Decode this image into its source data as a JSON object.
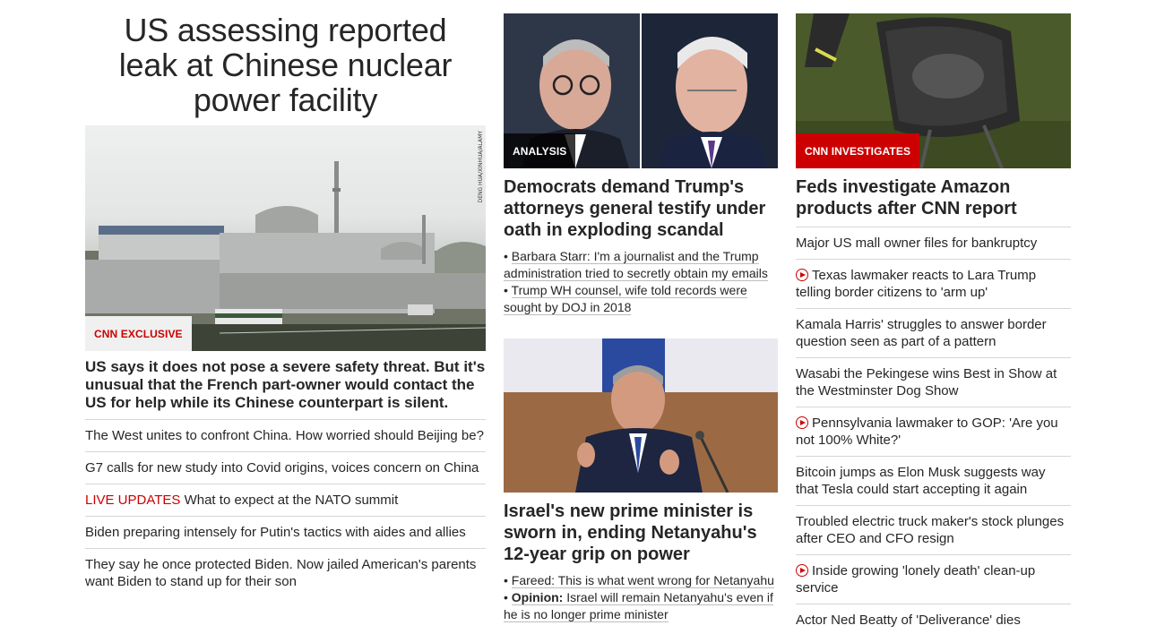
{
  "lead": {
    "headline": "US assessing reported leak at Chinese nuclear power facility",
    "image_credit": "DENG HUA/XINHUA/ALAMY",
    "badge": "CNN EXCLUSIVE",
    "summary": "US says it does not pose a severe safety threat. But it's unusual that the French part-owner would contact the US for help while its Chinese counterpart is silent.",
    "stories": [
      {
        "prefix": "",
        "text": "The West unites to confront China. How worried should Beijing be?"
      },
      {
        "prefix": "",
        "text": "G7 calls for new study into Covid origins, voices concern on China"
      },
      {
        "prefix": "LIVE UPDATES",
        "text": "What to expect at the NATO summit"
      },
      {
        "prefix": "",
        "text": "Biden preparing intensely for Putin's tactics with aides and allies"
      },
      {
        "prefix": "",
        "text": "They say he once protected Biden. Now jailed American's parents want Biden to stand up for their son"
      }
    ]
  },
  "middle": {
    "story1": {
      "badge": "ANALYSIS",
      "headline": "Democrats demand Trump's attorneys general testify under oath in exploding scandal",
      "links": [
        {
          "label": "",
          "text": "Barbara Starr: I'm a journalist and the Trump administration tried to secretly obtain my emails"
        },
        {
          "label": "",
          "text": "Trump WH counsel, wife told records were sought by DOJ in 2018"
        }
      ]
    },
    "story2": {
      "headline": "Israel's new prime minister is sworn in, ending Netanyahu's 12-year grip on power",
      "links": [
        {
          "label": "",
          "text": "Fareed: This is what went wrong for Netanyahu"
        },
        {
          "label": "Opinion:",
          "text": "Israel will remain Netanyahu's even if he is no longer prime minister"
        }
      ]
    }
  },
  "right": {
    "badge": "CNN INVESTIGATES",
    "headline": "Feds investigate Amazon products after CNN report",
    "stories": [
      {
        "video": false,
        "text": "Major US mall owner files for bankruptcy"
      },
      {
        "video": true,
        "text": "Texas lawmaker reacts to Lara Trump telling border citizens to 'arm up'"
      },
      {
        "video": false,
        "text": "Kamala Harris' struggles to answer border question seen as part of a pattern"
      },
      {
        "video": false,
        "text": "Wasabi the Pekingese wins Best in Show at the Westminster Dog Show"
      },
      {
        "video": true,
        "text": "Pennsylvania lawmaker to GOP: 'Are you not 100% White?'"
      },
      {
        "video": false,
        "text": "Bitcoin jumps as Elon Musk suggests way that Tesla could start accepting it again"
      },
      {
        "video": false,
        "text": "Troubled electric truck maker's stock plunges after CEO and CFO resign"
      },
      {
        "video": true,
        "text": "Inside growing 'lonely death' clean-up service"
      },
      {
        "video": false,
        "text": "Actor Ned Beatty of 'Deliverance' dies"
      }
    ]
  },
  "colors": {
    "accent_red": "#cc0000",
    "text": "#262626",
    "divider": "#d6d6d6"
  }
}
